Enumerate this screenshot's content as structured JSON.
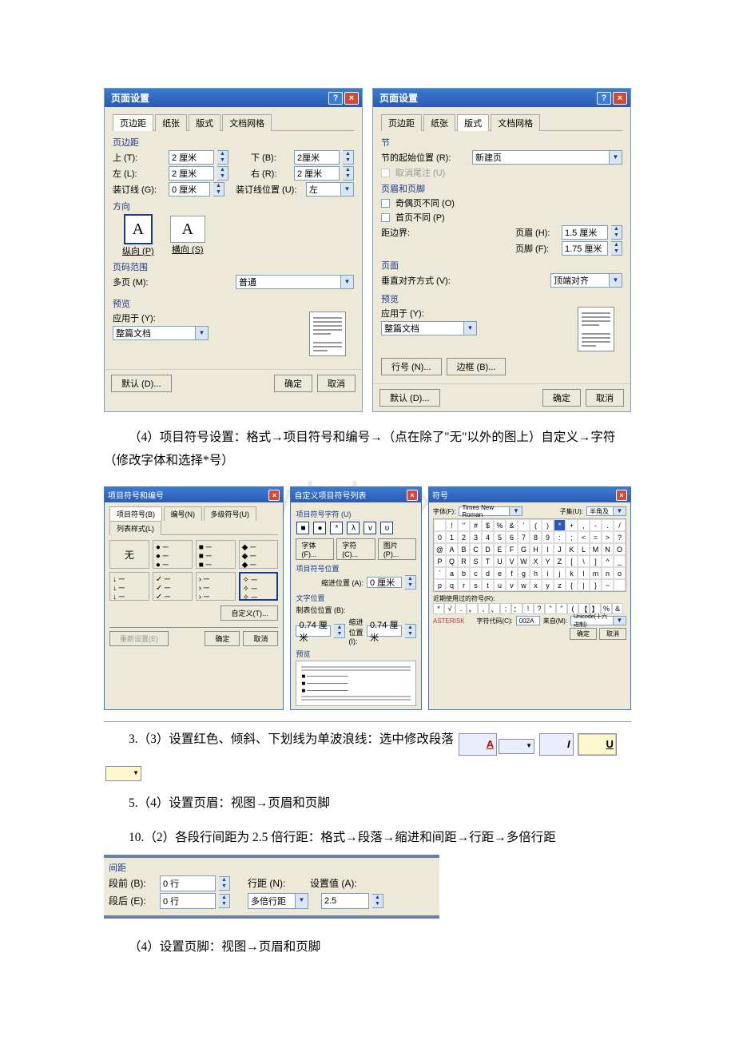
{
  "watermark": "www.bdocx.com",
  "dialog1": {
    "title": "页面设置",
    "tabs": {
      "t1": "页边距",
      "t2": "纸张",
      "t3": "版式",
      "t4": "文档网格"
    },
    "grp_margin": "页边距",
    "top_lbl": "上 (T):",
    "top_val": "2 厘米",
    "bot_lbl": "下 (B):",
    "bot_val": "2厘米",
    "left_lbl": "左 (L):",
    "left_val": "2 厘米",
    "right_lbl": "右 (R):",
    "right_val": "2 厘米",
    "bind_lbl": "装订线 (G):",
    "bind_val": "0 厘米",
    "bindpos_lbl": "装订线位置 (U):",
    "bindpos_val": "左",
    "grp_orient": "方向",
    "orient_p": "纵向 (P)",
    "orient_l": "横向 (S)",
    "grp_range": "页码范围",
    "multi_lbl": "多页 (M):",
    "multi_val": "普通",
    "grp_prev": "预览",
    "apply_lbl": "应用于 (Y):",
    "apply_val": "整篇文档",
    "default": "默认 (D)...",
    "ok": "确定",
    "cancel": "取消"
  },
  "dialog2": {
    "title": "页面设置",
    "tabs": {
      "t1": "页边距",
      "t2": "纸张",
      "t3": "版式",
      "t4": "文档网格"
    },
    "grp_sect": "节",
    "sectstart_lbl": "节的起始位置 (R):",
    "sectstart_val": "新建页",
    "endnote": "取消尾注 (U)",
    "grp_hf": "页眉和页脚",
    "oddeven": "奇偶页不同 (O)",
    "firstdiff": "首页不同 (P)",
    "edge_lbl": "距边界:",
    "header_lbl": "页眉 (H):",
    "header_val": "1.5 厘米",
    "footer_lbl": "页脚 (F):",
    "footer_val": "1.75 厘米",
    "grp_page": "页面",
    "valign_lbl": "垂直对齐方式 (V):",
    "valign_val": "顶端对齐",
    "grp_prev": "预览",
    "apply_lbl": "应用于 (Y):",
    "apply_val": "整篇文档",
    "lineno": "行号 (N)...",
    "border": "边框 (B)...",
    "default": "默认 (D)...",
    "ok": "确定",
    "cancel": "取消"
  },
  "para1": "（4）项目符号设置：格式→项目符号和编号→（点在除了\"无\"以外的图上）自定义→字符（修改字体和选择*号）",
  "bullets": {
    "title": "项目符号和编号",
    "tabs": {
      "t1": "项目符号(B)",
      "t2": "编号(N)",
      "t3": "多级符号(U)",
      "t4": "列表样式(L)"
    },
    "none": "无",
    "custom": "自定义(T)...",
    "reset": "重新设置(E)",
    "ok": "确定",
    "cancel": "取消"
  },
  "custom": {
    "title": "自定义项目符号列表",
    "lbl_char": "项目符号字符 (U)",
    "font": "字体(F)...",
    "char": "字符(C)...",
    "pic": "图片(P)...",
    "grp_pos": "项目符号位置",
    "indent_lbl": "缩进位置 (A):",
    "indent_val": "0 厘米",
    "grp_text": "文字位置",
    "tab_lbl": "制表位位置 (B):",
    "tab_val": "0.74 厘米",
    "indent2_lbl": "缩进位置 (I):",
    "indent2_val": "0.74 厘米",
    "prev": "预览"
  },
  "symbols": {
    "title": "符号",
    "font_lbl": "字体(F):",
    "font_val": "Times New Roman",
    "sub_lbl": "子集(U):",
    "sub_val": "半角及",
    "rows": [
      [
        "",
        "!",
        "\"",
        "#",
        "$",
        "%",
        "&",
        "'",
        "(",
        ")",
        "*",
        "+",
        ",",
        "-",
        ".",
        "/"
      ],
      [
        "0",
        "1",
        "2",
        "3",
        "4",
        "5",
        "6",
        "7",
        "8",
        "9",
        ":",
        ";",
        "<",
        "=",
        ">",
        "?"
      ],
      [
        "@",
        "A",
        "B",
        "C",
        "D",
        "E",
        "F",
        "G",
        "H",
        "I",
        "J",
        "K",
        "L",
        "M",
        "N",
        "O"
      ],
      [
        "P",
        "Q",
        "R",
        "S",
        "T",
        "U",
        "V",
        "W",
        "X",
        "Y",
        "Z",
        "[",
        "\\",
        "]",
        "^",
        "_"
      ],
      [
        "`",
        "a",
        "b",
        "c",
        "d",
        "e",
        "f",
        "g",
        "h",
        "i",
        "j",
        "k",
        "l",
        "m",
        "n",
        "o"
      ],
      [
        "p",
        "q",
        "r",
        "s",
        "t",
        "u",
        "v",
        "w",
        "x",
        "y",
        "z",
        "{",
        "|",
        "}",
        "~",
        ""
      ]
    ],
    "recent_lbl": "近期使用过的符号(R):",
    "recent": [
      "*",
      "√",
      ".",
      "。",
      ",",
      "、",
      ";",
      "：",
      "!",
      "?",
      "\"",
      "\"",
      "(",
      "【",
      "】",
      "%",
      "&"
    ],
    "name": "ASTERISK",
    "code_lbl": "字符代码(C):",
    "code": "002A",
    "from_lbl": "来自(M):",
    "from": "Unicode(十六进制)",
    "ok": "确定",
    "cancel": "取消"
  },
  "para_fmt": "3.（3）设置红色、倾斜、下划线为单波浪线：选中修改段落",
  "para_hf": "5.（4）设置页眉：视图→页眉和页脚",
  "para_ls": "10.（2）各段行间距为 2.5 倍行距：格式→段落→缩进和间距→行距→多倍行距",
  "spacing": {
    "title": "间距",
    "before_lbl": "段前 (B):",
    "before_val": "0 行",
    "after_lbl": "段后 (E):",
    "after_val": "0 行",
    "ls_lbl": "行距 (N):",
    "ls_val": "多倍行距",
    "set_lbl": "设置值 (A):",
    "set_val": "2.5"
  },
  "para_footer": "（4）设置页脚：视图→页眉和页脚"
}
